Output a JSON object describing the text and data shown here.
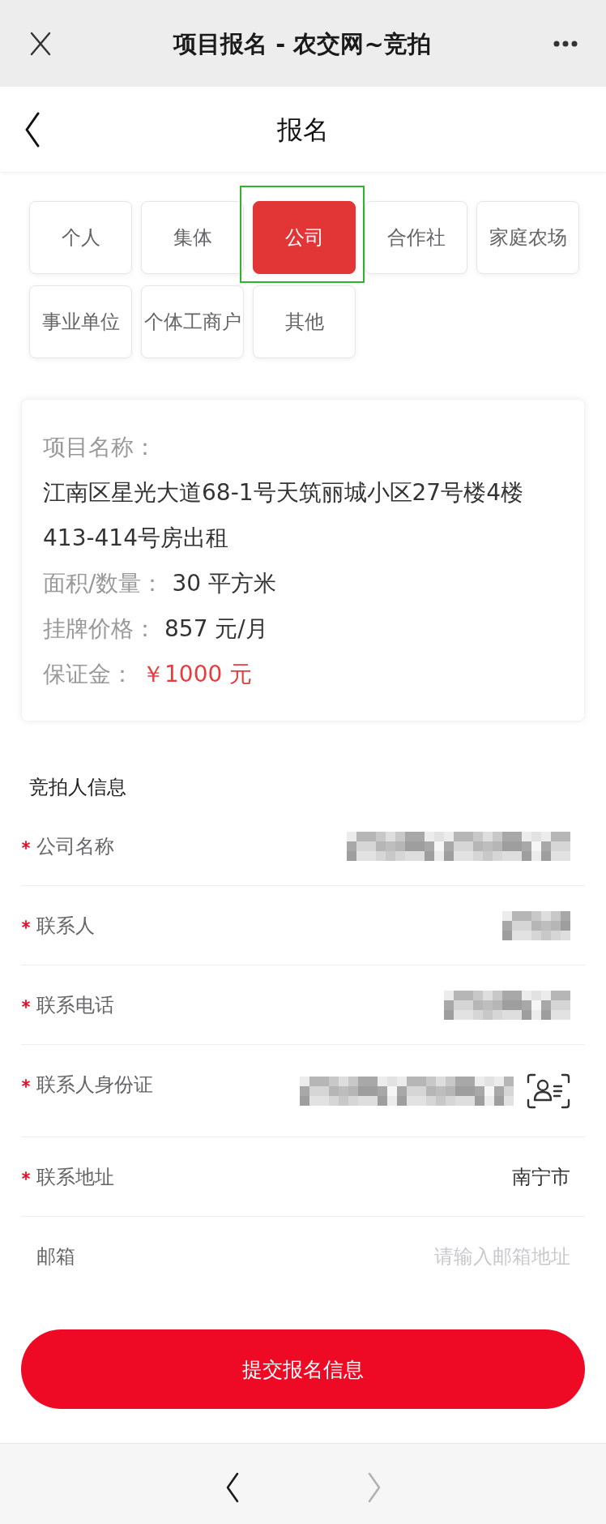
{
  "window": {
    "title": "项目报名 - 农交网~竞拍"
  },
  "nav": {
    "title": "报名"
  },
  "entity_types": [
    {
      "label": "个人",
      "selected": false
    },
    {
      "label": "集体",
      "selected": false
    },
    {
      "label": "公司",
      "selected": true
    },
    {
      "label": "合作社",
      "selected": false
    },
    {
      "label": "家庭农场",
      "selected": false
    },
    {
      "label": "事业单位",
      "selected": false
    },
    {
      "label": "个体工商户",
      "selected": false
    },
    {
      "label": "其他",
      "selected": false
    }
  ],
  "project": {
    "name_label": "项目名称：",
    "name": "江南区星光大道68-1号天筑丽城小区27号楼4楼413-414号房出租",
    "details": [
      {
        "label": "面积/数量：",
        "value": "30 平方米",
        "highlight": false
      },
      {
        "label": "挂牌价格：",
        "value": "857 元/月",
        "highlight": false
      },
      {
        "label": "保证金：",
        "value": "￥1000 元",
        "highlight": true
      }
    ]
  },
  "bidder_section": {
    "title": "竞拍人信息",
    "fields": [
      {
        "kind": "company",
        "label": "公司名称",
        "required": true,
        "redacted": true
      },
      {
        "kind": "contact",
        "label": "联系人",
        "required": true,
        "redacted": true
      },
      {
        "kind": "phone",
        "label": "联系电话",
        "required": true,
        "redacted": true
      },
      {
        "kind": "id",
        "label": "联系人身份证",
        "required": true,
        "redacted": true
      },
      {
        "kind": "address",
        "label": "联系地址",
        "required": true,
        "redacted": false,
        "value": "南宁市"
      },
      {
        "kind": "email",
        "label": "邮箱",
        "required": false,
        "redacted": false,
        "placeholder": "请输入邮箱地址"
      }
    ]
  },
  "submit_button": {
    "label": "提交报名信息"
  },
  "toolbar": [
    {
      "kind": "back",
      "disabled": false
    },
    {
      "kind": "forward",
      "disabled": true
    }
  ]
}
